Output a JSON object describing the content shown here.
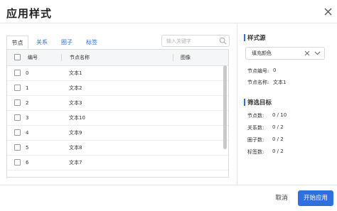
{
  "dialog": {
    "title": "应用样式"
  },
  "tabs": [
    {
      "label": "节点",
      "active": true
    },
    {
      "label": "关系",
      "active": false
    },
    {
      "label": "圈子",
      "active": false
    },
    {
      "label": "标签",
      "active": false
    }
  ],
  "search": {
    "placeholder": "输入关键字"
  },
  "table": {
    "columns": [
      "编号",
      "节点名称",
      "图像"
    ],
    "rows": [
      {
        "id": "0",
        "name": "文本1"
      },
      {
        "id": "1",
        "name": "文本2"
      },
      {
        "id": "2",
        "name": "文本3"
      },
      {
        "id": "3",
        "name": "文本10"
      },
      {
        "id": "4",
        "name": "文本9"
      },
      {
        "id": "5",
        "name": "文本8"
      },
      {
        "id": "6",
        "name": "文本7"
      }
    ]
  },
  "style_source": {
    "title": "样式源",
    "select_value": "填充颜色",
    "node_id_label": "节点编号:",
    "node_id_value": "0",
    "node_name_label": "节点名称:",
    "node_name_value": "文本1"
  },
  "filter_target": {
    "title": "筛选目标",
    "items": [
      {
        "label": "节点数:",
        "value": "0 / 10"
      },
      {
        "label": "关系数:",
        "value": "0 / 2"
      },
      {
        "label": "圈子数:",
        "value": "0 / 2"
      },
      {
        "label": "标签数:",
        "value": "0 / 2"
      }
    ]
  },
  "footer": {
    "cancel_label": "取消",
    "confirm_label": "开始应用"
  },
  "colors": {
    "accent": "#2f6fe0",
    "border": "#dcdcdc",
    "header_bg": "#f5f6f7"
  }
}
